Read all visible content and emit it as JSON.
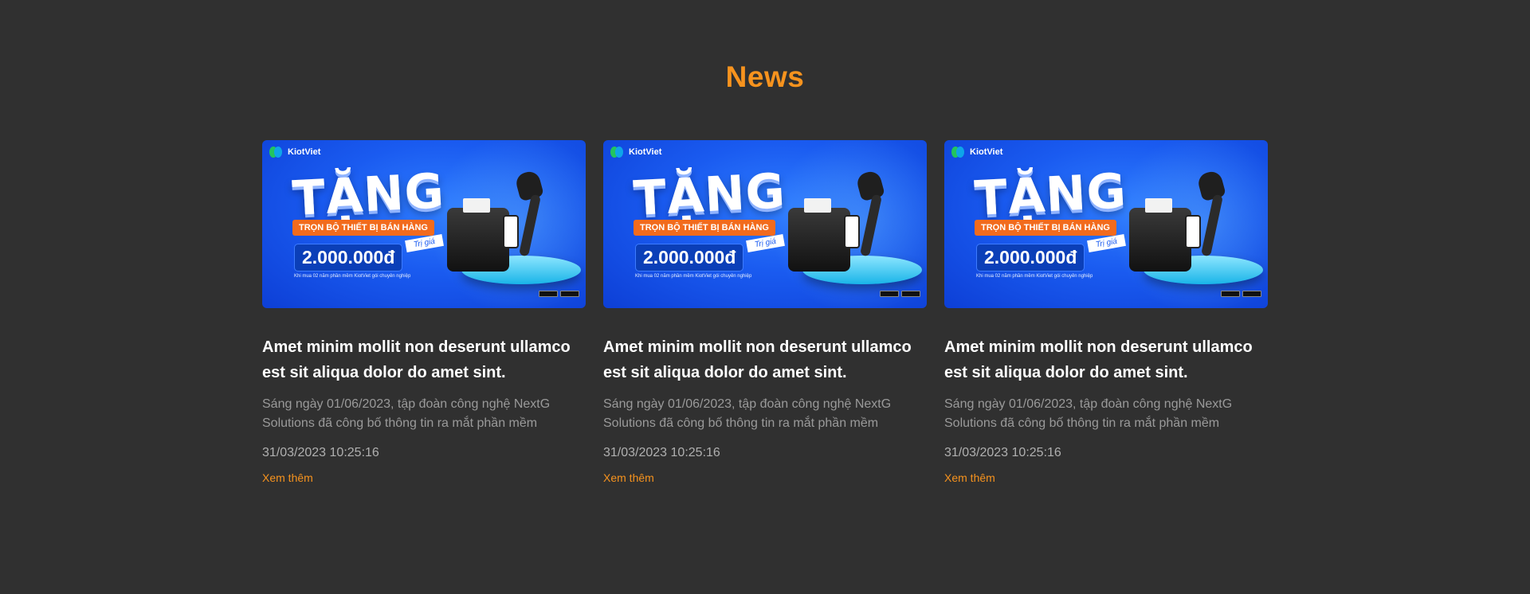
{
  "section": {
    "title": "News"
  },
  "cards": [
    {
      "banner": {
        "brand": "KiotViet",
        "headline": "TẶNG",
        "ribbon": "TRỌN BỘ THIẾT BỊ BÁN HÀNG",
        "tag": "Trị giá",
        "price": "2.000.000đ",
        "note": "Khi mua 02 năm phần mềm KiotViet gói chuyên nghiệp"
      },
      "title": "Amet minim mollit non deserunt ullamco est sit aliqua dolor do amet sint.",
      "description": "Sáng ngày 01/06/2023, tập đoàn công nghệ NextG Solutions đã công bố thông tin ra mắt phần mềm",
      "date": "31/03/2023 10:25:16",
      "more": "Xem thêm"
    },
    {
      "banner": {
        "brand": "KiotViet",
        "headline": "TẶNG",
        "ribbon": "TRỌN BỘ THIẾT BỊ BÁN HÀNG",
        "tag": "Trị giá",
        "price": "2.000.000đ",
        "note": "Khi mua 02 năm phần mềm KiotViet gói chuyên nghiệp"
      },
      "title": "Amet minim mollit non deserunt ullamco est sit aliqua dolor do amet sint.",
      "description": "Sáng ngày 01/06/2023, tập đoàn công nghệ NextG Solutions đã công bố thông tin ra mắt phần mềm",
      "date": "31/03/2023 10:25:16",
      "more": "Xem thêm"
    },
    {
      "banner": {
        "brand": "KiotViet",
        "headline": "TẶNG",
        "ribbon": "TRỌN BỘ THIẾT BỊ BÁN HÀNG",
        "tag": "Trị giá",
        "price": "2.000.000đ",
        "note": "Khi mua 02 năm phần mềm KiotViet gói chuyên nghiệp"
      },
      "title": "Amet minim mollit non deserunt ullamco est sit aliqua dolor do amet sint.",
      "description": "Sáng ngày 01/06/2023, tập đoàn công nghệ NextG Solutions đã công bố thông tin ra mắt phần mềm",
      "date": "31/03/2023 10:25:16",
      "more": "Xem thêm"
    }
  ],
  "colors": {
    "background": "#303030",
    "accent": "#F7931E",
    "banner_blue": "#1a5bf0"
  }
}
